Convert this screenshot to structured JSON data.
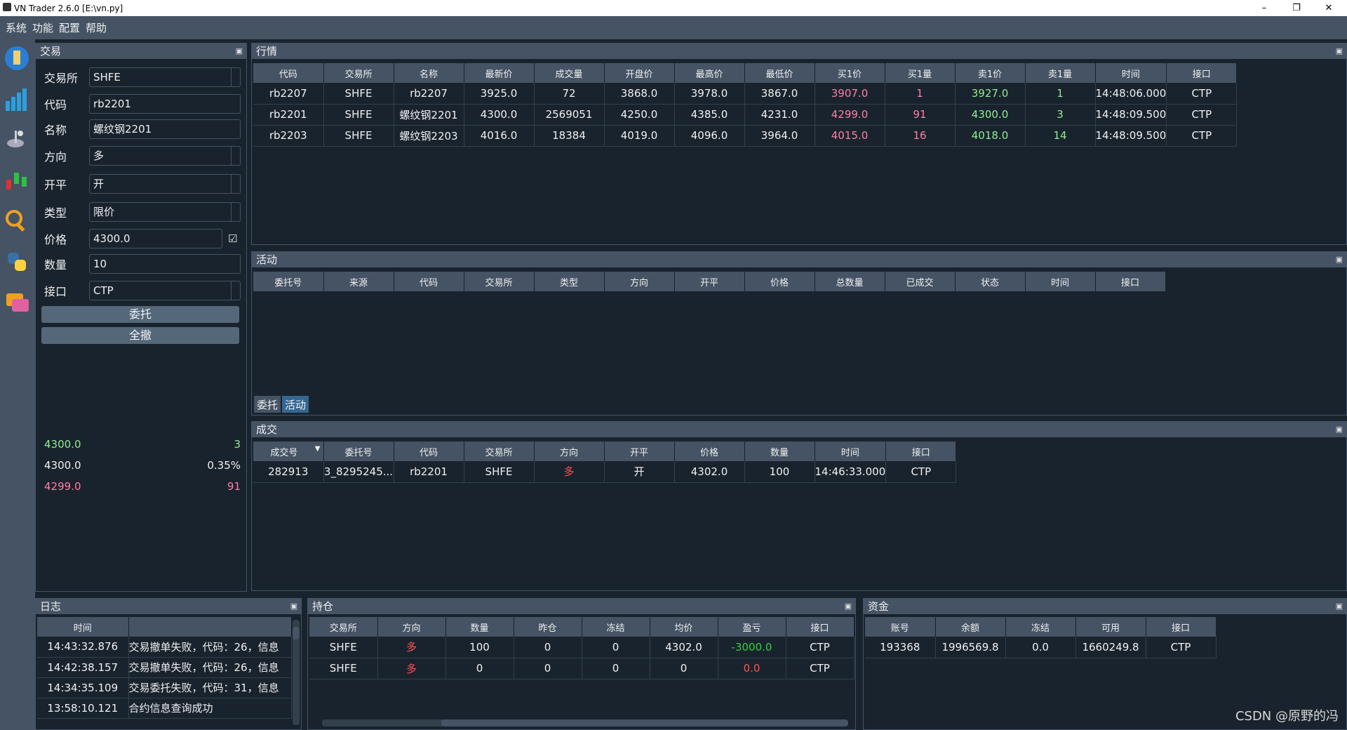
{
  "window": {
    "title": "VN Trader 2.6.0 [E:\\vn.py]",
    "min": "–",
    "max": "❐",
    "close": "✕"
  },
  "menu": [
    "系统",
    "功能",
    "配置",
    "帮助"
  ],
  "trade": {
    "title": "交易",
    "fields": [
      {
        "label": "交易所",
        "value": "SHFE",
        "dropdown": true
      },
      {
        "label": "代码",
        "value": "rb2201",
        "dropdown": false
      },
      {
        "label": "名称",
        "value": "螺纹钢2201",
        "dropdown": false
      },
      {
        "label": "方向",
        "value": "多",
        "dropdown": true
      },
      {
        "label": "开平",
        "value": "开",
        "dropdown": true
      },
      {
        "label": "类型",
        "value": "限价",
        "dropdown": true
      },
      {
        "label": "价格",
        "value": "4300.0",
        "dropdown": false
      },
      {
        "label": "数量",
        "value": "10",
        "dropdown": false
      },
      {
        "label": "接口",
        "value": "CTP",
        "dropdown": true
      }
    ],
    "price_checkbox": "☑",
    "submit": "委托",
    "cancel_all": "全撤",
    "depth": [
      {
        "price": "4300.0",
        "vol": "3",
        "color": "#90ee90"
      },
      {
        "price": "4300.0",
        "vol": "0.35%",
        "color": "#f0f0f0"
      },
      {
        "price": "4299.0",
        "vol": "91",
        "color": "#ff7fa5"
      }
    ]
  },
  "market": {
    "title": "行情",
    "headers": [
      "代码",
      "交易所",
      "名称",
      "最新价",
      "成交量",
      "开盘价",
      "最高价",
      "最低价",
      "买1价",
      "买1量",
      "卖1价",
      "卖1量",
      "时间",
      "接口"
    ],
    "rows": [
      [
        "rb2207",
        "SHFE",
        "rb2207",
        "3925.0",
        "72",
        "3868.0",
        "3978.0",
        "3867.0",
        "3907.0",
        "1",
        "3927.0",
        "1",
        "14:48:06.000",
        "CTP"
      ],
      [
        "rb2201",
        "SHFE",
        "螺纹钢2201",
        "4300.0",
        "2569051",
        "4250.0",
        "4385.0",
        "4231.0",
        "4299.0",
        "91",
        "4300.0",
        "3",
        "14:48:09.500",
        "CTP"
      ],
      [
        "rb2203",
        "SHFE",
        "螺纹钢2203",
        "4016.0",
        "18384",
        "4019.0",
        "4096.0",
        "3964.0",
        "4015.0",
        "16",
        "4018.0",
        "14",
        "14:48:09.500",
        "CTP"
      ]
    ]
  },
  "active": {
    "title": "活动",
    "headers": [
      "委托号",
      "来源",
      "代码",
      "交易所",
      "类型",
      "方向",
      "开平",
      "价格",
      "总数量",
      "已成交",
      "状态",
      "时间",
      "接口"
    ],
    "tabs": [
      "委托",
      "活动"
    ]
  },
  "trades": {
    "title": "成交",
    "headers": [
      "成交号",
      "委托号",
      "代码",
      "交易所",
      "方向",
      "开平",
      "价格",
      "数量",
      "时间",
      "接口"
    ],
    "sort_arrow": "▼",
    "rows": [
      [
        "282913",
        "3_8295245...",
        "rb2201",
        "SHFE",
        "多",
        "开",
        "4302.0",
        "100",
        "14:46:33.000",
        "CTP"
      ]
    ]
  },
  "log": {
    "title": "日志",
    "headers": [
      "时间",
      ""
    ],
    "rows": [
      [
        "14:43:32.876",
        "交易撤单失败，代码：26，信息"
      ],
      [
        "14:42:38.157",
        "交易撤单失败，代码：26，信息"
      ],
      [
        "14:34:35.109",
        "交易委托失败，代码：31，信息"
      ],
      [
        "13:58:10.121",
        "合约信息查询成功"
      ]
    ]
  },
  "position": {
    "title": "持仓",
    "headers": [
      "交易所",
      "方向",
      "数量",
      "昨仓",
      "冻结",
      "均价",
      "盈亏",
      "接口"
    ],
    "rows": [
      [
        "SHFE",
        "多",
        "100",
        "0",
        "0",
        "4302.0",
        "-3000.0",
        "CTP"
      ],
      [
        "SHFE",
        "多",
        "0",
        "0",
        "0",
        "0",
        "0.0",
        "CTP"
      ]
    ]
  },
  "account": {
    "title": "资金",
    "headers": [
      "账号",
      "余额",
      "冻结",
      "可用",
      "接口"
    ],
    "rows": [
      [
        "193368",
        "1996569.8",
        "0.0",
        "1660249.8",
        "CTP"
      ]
    ]
  },
  "watermark": "CSDN @原野的冯",
  "float_icon": "▣"
}
